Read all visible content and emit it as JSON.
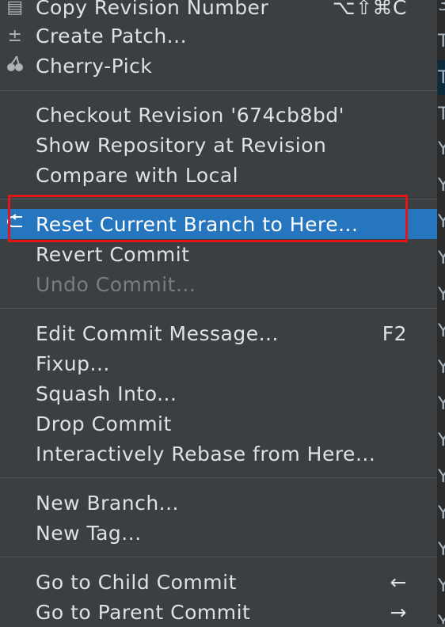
{
  "menu": {
    "items": [
      {
        "label": "Copy Revision Number",
        "shortcut": "⌥⇧⌘C",
        "icon": "copy-icon"
      },
      {
        "label": "Create Patch...",
        "icon": "patch-icon"
      },
      {
        "label": "Cherry-Pick",
        "icon": "cherry-icon"
      },
      {
        "label": "Checkout Revision '674cb8bd'"
      },
      {
        "label": "Show Repository at Revision"
      },
      {
        "label": "Compare with Local"
      },
      {
        "label": "Reset Current Branch to Here...",
        "icon": "reset-icon",
        "state": "selected"
      },
      {
        "label": "Revert Commit"
      },
      {
        "label": "Undo Commit...",
        "state": "disabled"
      },
      {
        "label": "Edit Commit Message...",
        "shortcut": "F2"
      },
      {
        "label": "Fixup..."
      },
      {
        "label": "Squash Into..."
      },
      {
        "label": "Drop Commit"
      },
      {
        "label": "Interactively Rebase from Here..."
      },
      {
        "label": "New Branch..."
      },
      {
        "label": "New Tag..."
      },
      {
        "label": "Go to Child Commit",
        "shortcut": "←"
      },
      {
        "label": "Go to Parent Commit",
        "shortcut": "→"
      }
    ]
  },
  "right_panel": {
    "glyphs": [
      "3",
      "T",
      "T",
      "T",
      "Y",
      "Y",
      "Y",
      "Y",
      "Y",
      "Y",
      "Y",
      "Y",
      "Y",
      "Y",
      "Y",
      "Y",
      "Y",
      "Y",
      "Y"
    ]
  },
  "colors": {
    "menu_bg": "#3c3f41",
    "selected_bg": "#2675bf",
    "highlight_border": "#e3141a",
    "text": "#dfe1e5",
    "disabled_text": "#7a7d80"
  }
}
